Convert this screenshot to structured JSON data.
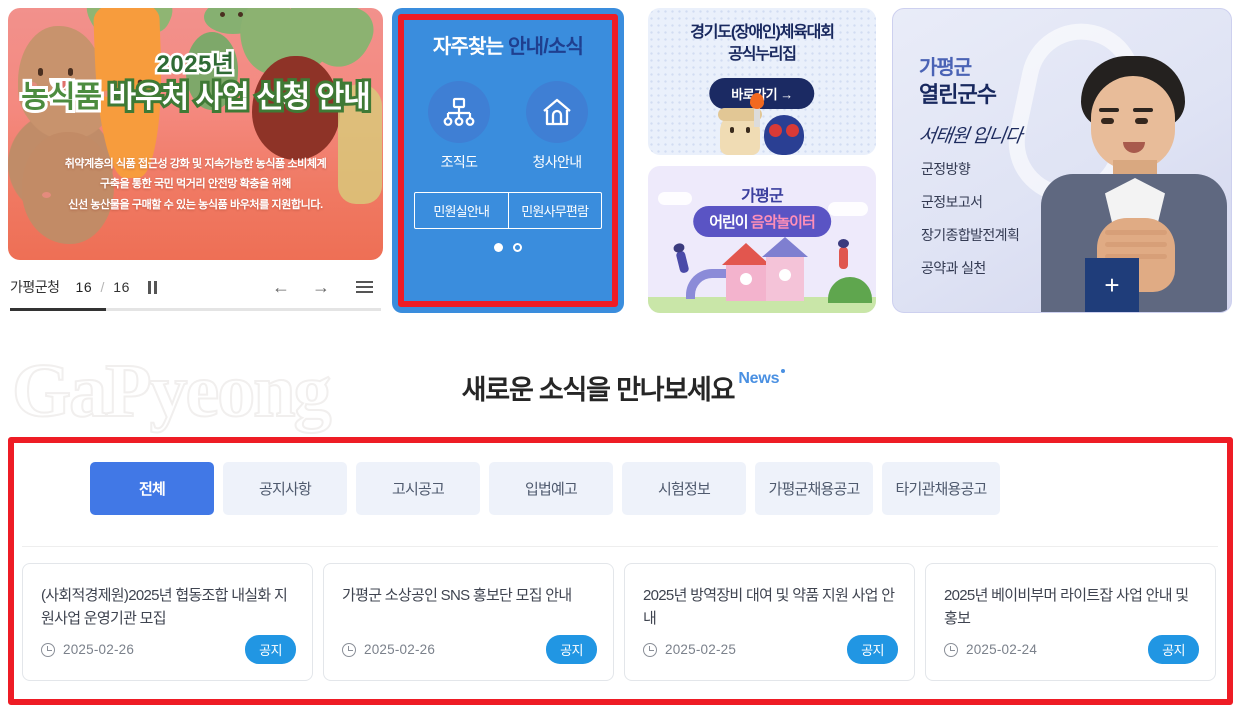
{
  "hero": {
    "year": "2025년",
    "title_green": "농식품",
    "title_white": "바우처 사업 신청 안내",
    "sub_line1": "취약계층의 식품 접근성 강화 및 지속가능한 농식품 소비체계",
    "sub_line2": "구축을 통한 국민 먹거리 안전망 확충을 위해",
    "sub_line3": "신선 농산물을 구매할 수 있는 농식품 바우처를 지원합니다.",
    "slider_label": "가평군청",
    "current_slide": "16",
    "separator": "/",
    "total_slides": "16",
    "prev_arrow": "←",
    "next_arrow": "→"
  },
  "quick": {
    "title_bold": "자주찾는",
    "title_rest": " 안내/소식",
    "items": [
      {
        "label": "조직도",
        "icon": "org-chart-icon"
      },
      {
        "label": "청사안내",
        "icon": "home-icon"
      }
    ],
    "buttons": [
      "민원실안내",
      "민원사무편람"
    ]
  },
  "banners": {
    "sports": {
      "line1": "경기도(장애인)체육대회",
      "line2": "공식누리집",
      "button": "바로가기 →"
    },
    "playground": {
      "line1": "가평군",
      "tag_a": "어린이 ",
      "tag_b": "음악놀이터"
    }
  },
  "governor": {
    "title_top": "가평군",
    "title_main": "열린군수",
    "signature": "서태원 입니다",
    "links": [
      "군정방향",
      "군정보고서",
      "장기종합발전계획",
      "공약과 실천"
    ],
    "plus": "+"
  },
  "news": {
    "watermark": "GaPyeong",
    "heading_kr": "새로운 소식을 만나보세요",
    "heading_en": "News",
    "tabs": [
      {
        "label": "전체",
        "active": true
      },
      {
        "label": "공지사항",
        "active": false
      },
      {
        "label": "고시공고",
        "active": false
      },
      {
        "label": "입법예고",
        "active": false
      },
      {
        "label": "시험정보",
        "active": false
      },
      {
        "label": "가평군채용공고",
        "active": false
      },
      {
        "label": "타기관채용공고",
        "active": false
      }
    ],
    "cards": [
      {
        "title": "(사회적경제원)2025년 협동조합 내실화 지원사업 운영기관 모집",
        "date": "2025-02-26",
        "badge": "공지"
      },
      {
        "title": "가평군 소상공인 SNS 홍보단 모집 안내",
        "date": "2025-02-26",
        "badge": "공지"
      },
      {
        "title": "2025년 방역장비 대여 및 약품 지원 사업 안내",
        "date": "2025-02-25",
        "badge": "공지"
      },
      {
        "title": "2025년 베이비부머 라이트잡 사업 안내 및 홍보",
        "date": "2025-02-24",
        "badge": "공지"
      }
    ]
  },
  "colors": {
    "accent_blue": "#4178e6",
    "panel_blue": "#3a8ddd",
    "badge_blue": "#2196e3",
    "annotation_red": "#ee1c25",
    "navy": "#18285e"
  }
}
